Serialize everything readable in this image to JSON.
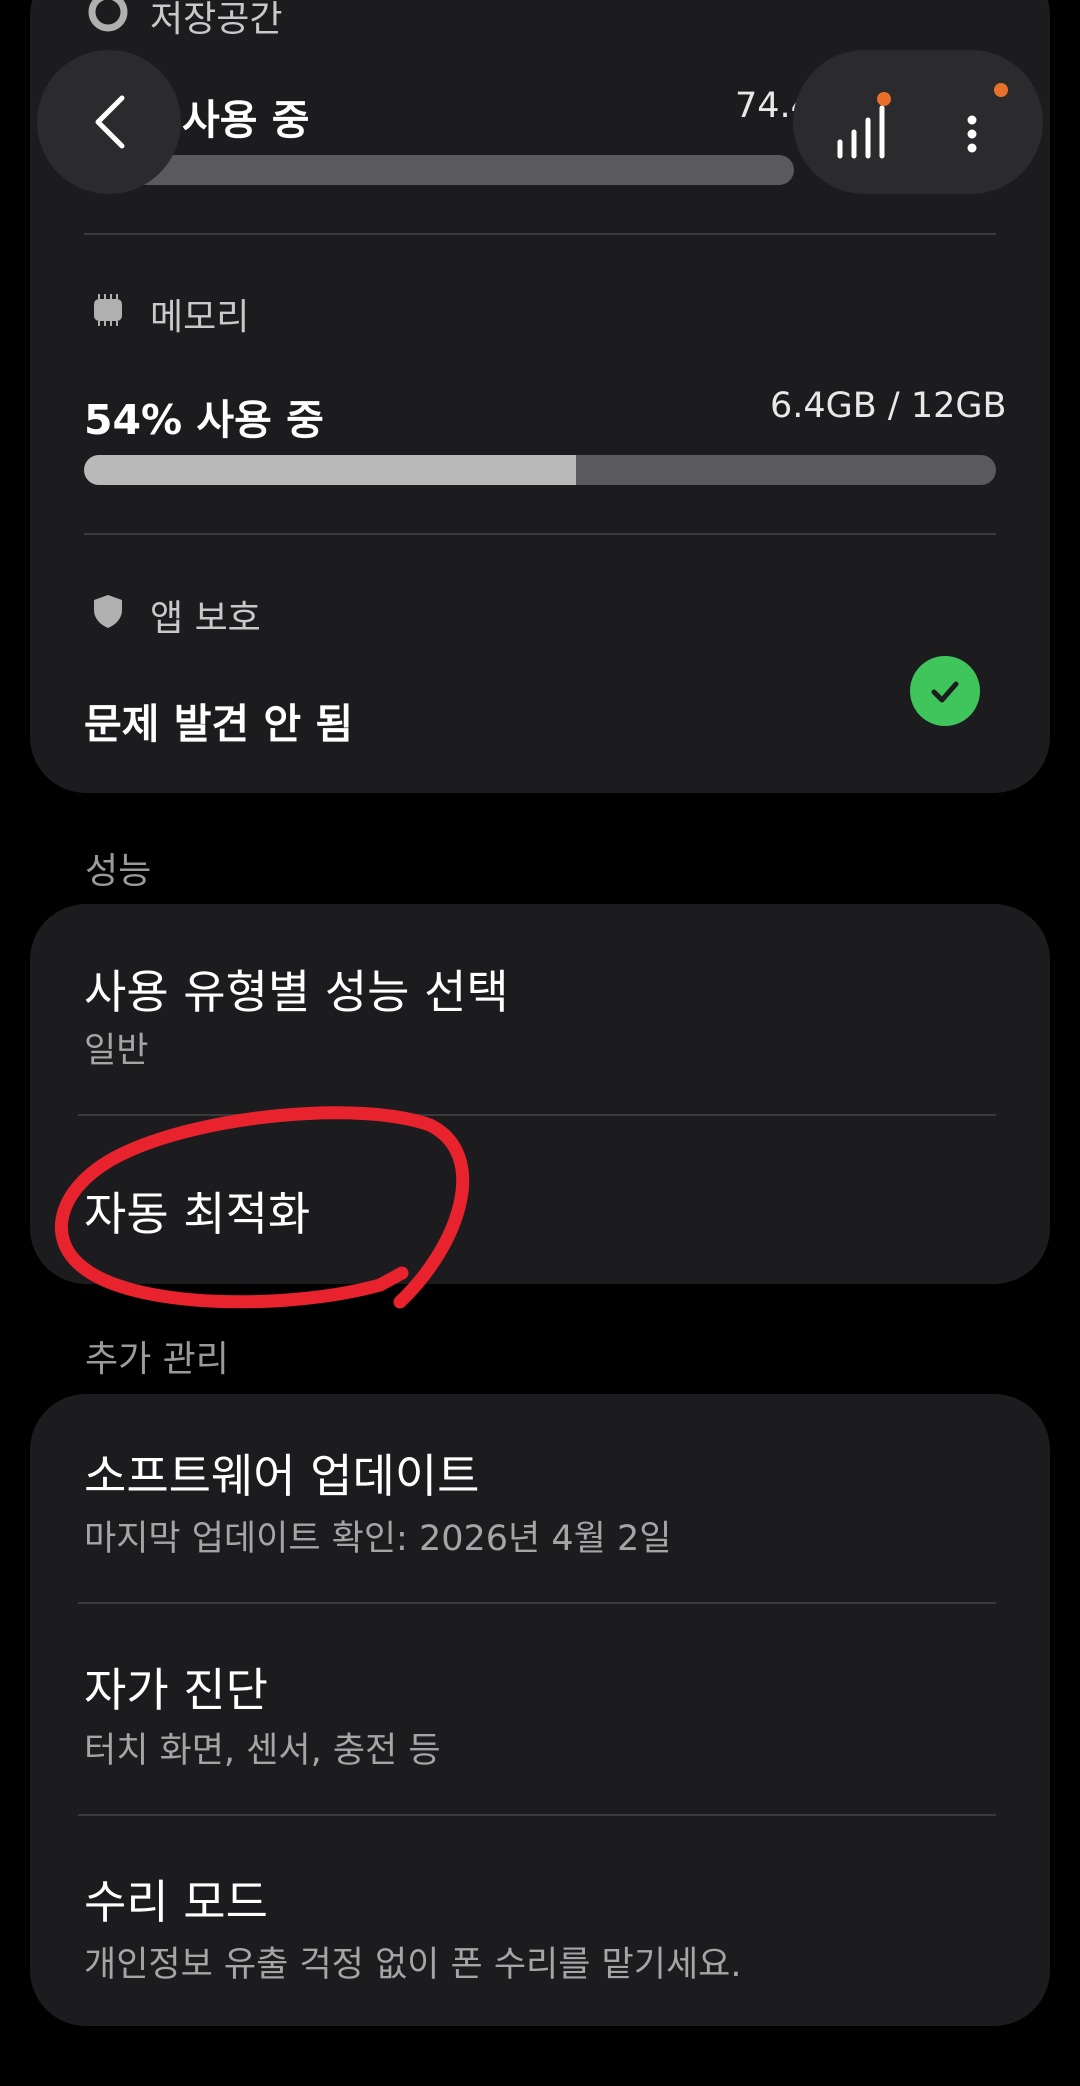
{
  "device_care": {
    "storage": {
      "label": "저장공간",
      "usage_text": "사용 중",
      "amount_partial": "74.4",
      "fill_fraction": 0.08
    },
    "memory": {
      "label": "메모리",
      "usage_text": "54% 사용 중",
      "amount": "6.4GB / 12GB",
      "fill_fraction": 0.54
    },
    "app_protection": {
      "label": "앱 보호",
      "status": "문제 발견 안 됨",
      "status_color": "#3fc55b"
    }
  },
  "performance": {
    "section_title": "성능",
    "items": [
      {
        "title": "사용 유형별 성능 선택",
        "subtitle": "일반"
      },
      {
        "title": "자동 최적화"
      }
    ],
    "annotation_color": "#e8232d"
  },
  "extra": {
    "section_title": "추가 관리",
    "items": [
      {
        "title": "소프트웨어 업데이트",
        "subtitle": "마지막 업데이트 확인: 2026년 4월 2일"
      },
      {
        "title": "자가 진단",
        "subtitle": "터치 화면, 센서, 충전 등"
      },
      {
        "title": "수리 모드",
        "subtitle": "개인정보 유출 걱정 없이 폰 수리를 맡기세요."
      }
    ]
  },
  "icons": {
    "back": "chevron-left-icon",
    "stats": "bar-chart-icon",
    "more": "more-vertical-icon",
    "notification_color": "#e8702a"
  }
}
